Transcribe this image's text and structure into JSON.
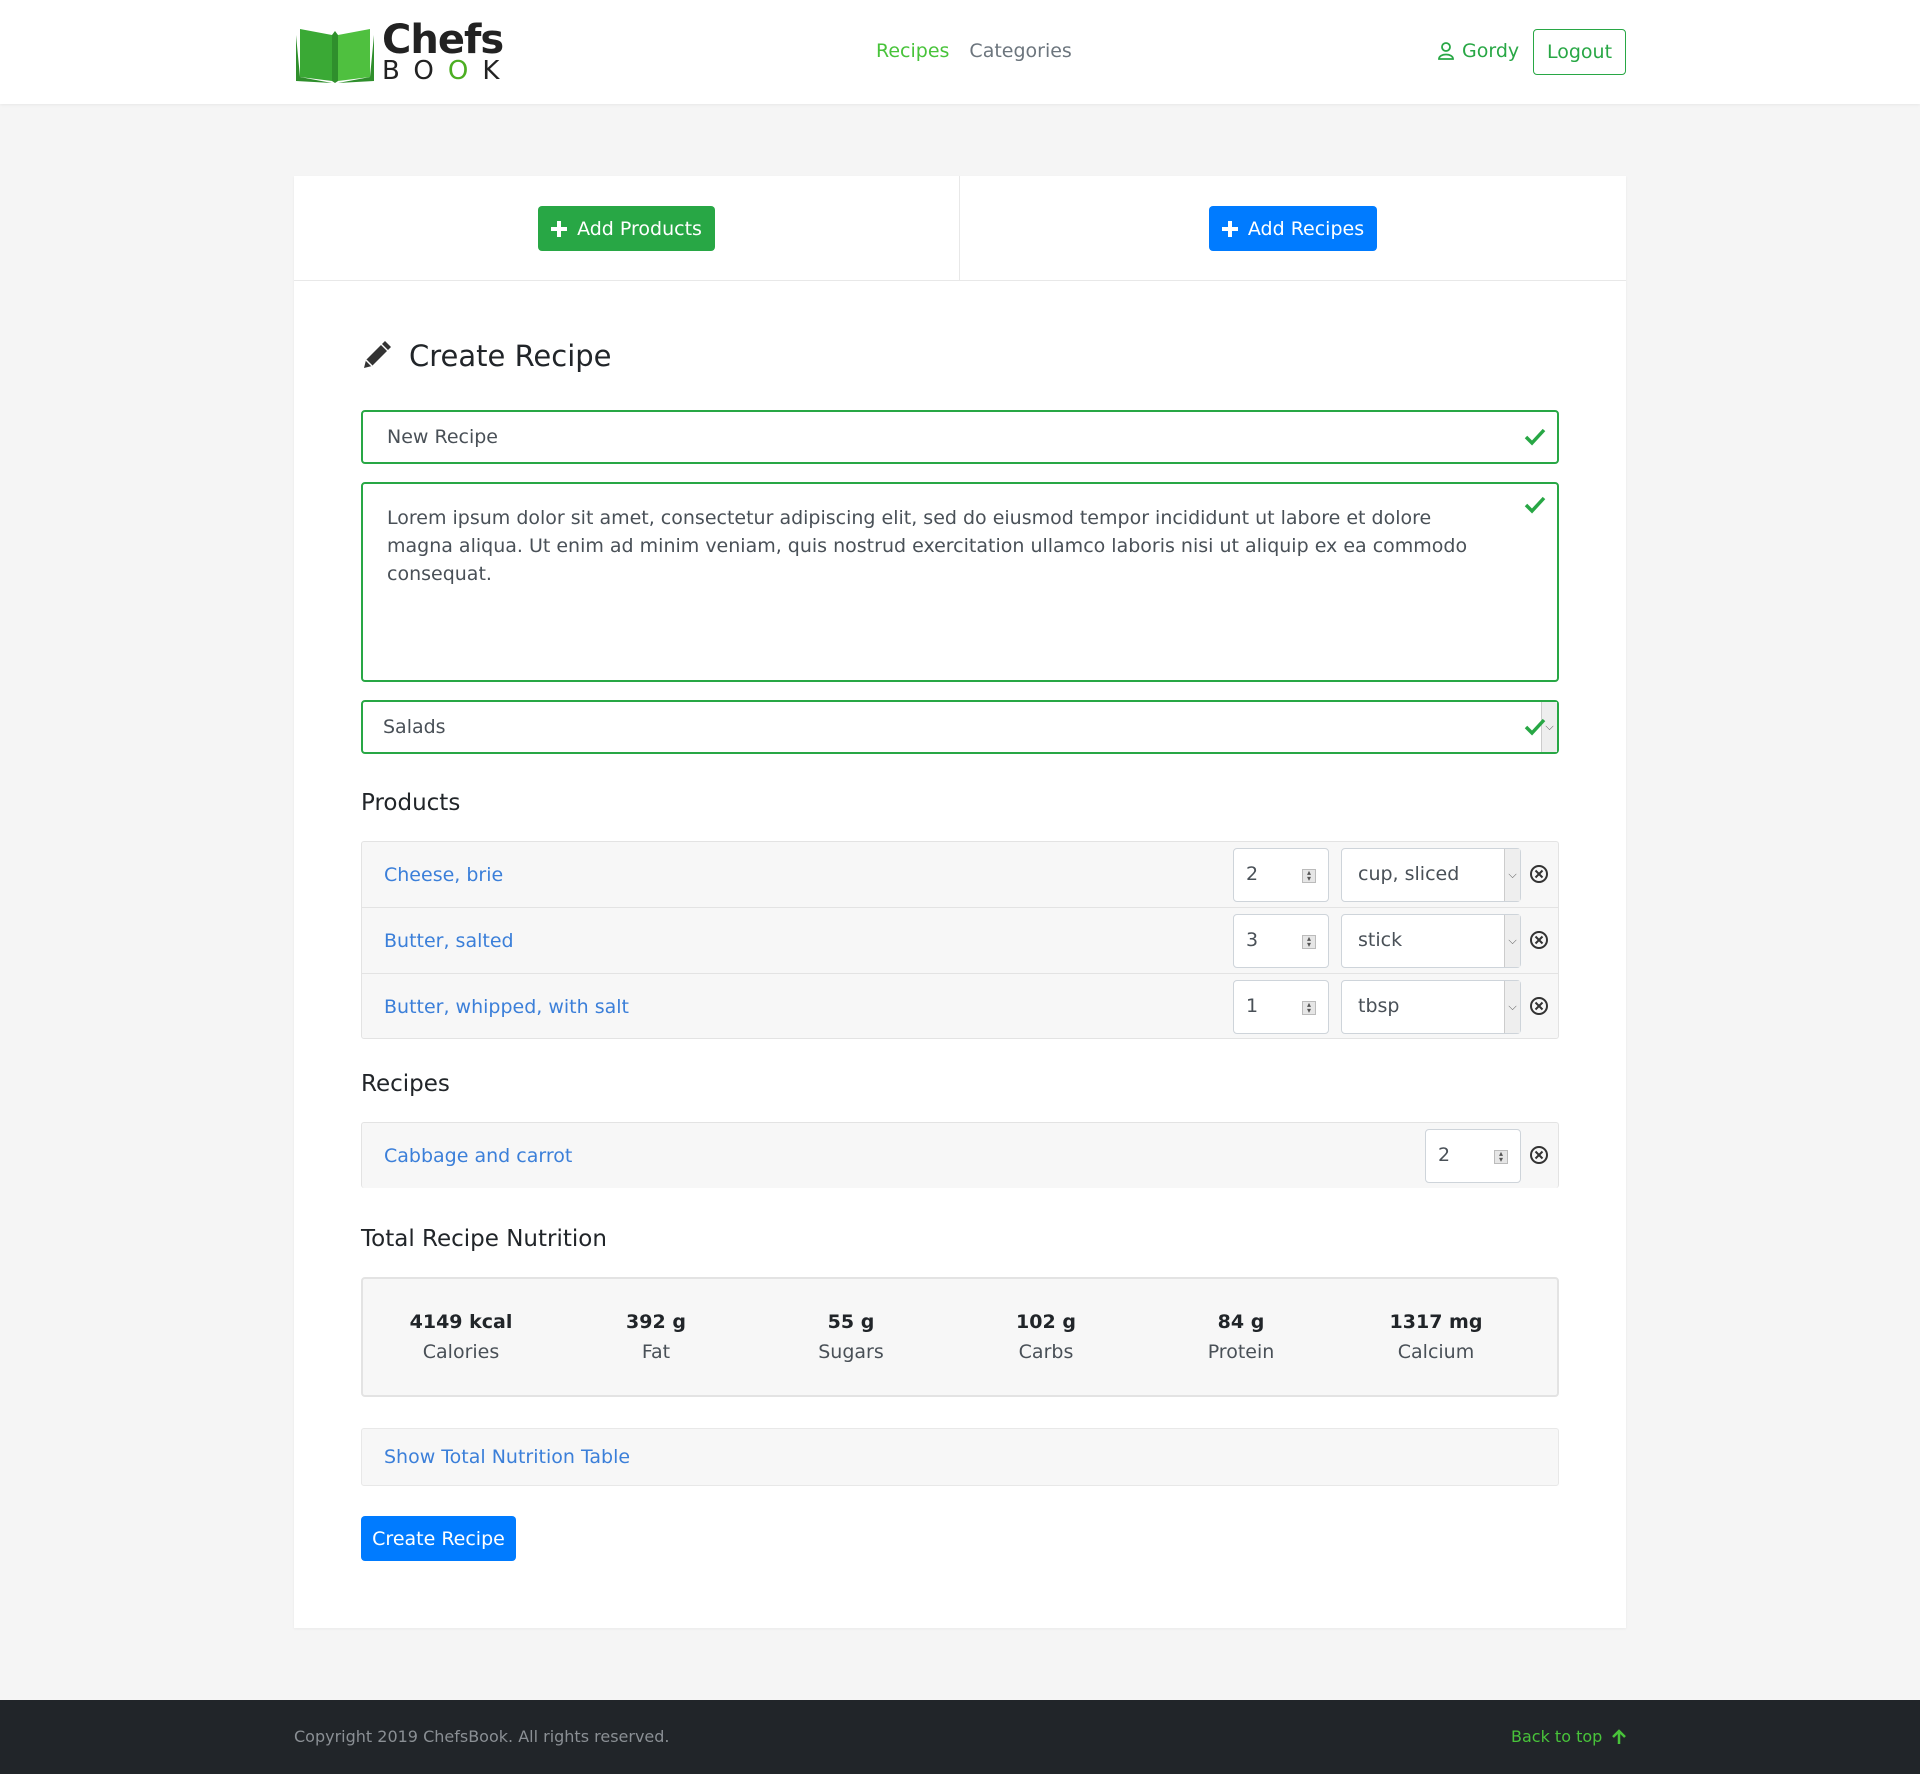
{
  "brand": {
    "line1": "Chefs",
    "line2": [
      "B",
      "O",
      "O",
      "K"
    ]
  },
  "nav": {
    "recipes": "Recipes",
    "categories": "Categories"
  },
  "user": {
    "name": "Gordy",
    "logout": "Logout"
  },
  "actions": {
    "add_products": "Add Products",
    "add_recipes": "Add Recipes"
  },
  "form": {
    "heading": "Create Recipe",
    "name_value": "New Recipe",
    "description_value": "Lorem ipsum dolor sit amet, consectetur adipiscing elit, sed do eiusmod tempor incididunt ut labore et dolore magna aliqua. Ut enim ad minim veniam, quis nostrud exercitation ullamco laboris nisi ut aliquip ex ea commodo consequat.",
    "category_value": "Salads"
  },
  "products": {
    "title": "Products",
    "items": [
      {
        "name": "Cheese, brie",
        "quantity": "2",
        "unit": "cup, sliced"
      },
      {
        "name": "Butter, salted",
        "quantity": "3",
        "unit": "stick"
      },
      {
        "name": "Butter, whipped, with salt",
        "quantity": "1",
        "unit": "tbsp"
      }
    ]
  },
  "recipes": {
    "title": "Recipes",
    "items": [
      {
        "name": "Cabbage and carrot",
        "quantity": "2"
      }
    ]
  },
  "nutrition": {
    "title": "Total Recipe Nutrition",
    "items": [
      {
        "value": "4149 kcal",
        "label": "Calories"
      },
      {
        "value": "392 g",
        "label": "Fat"
      },
      {
        "value": "55 g",
        "label": "Sugars"
      },
      {
        "value": "102 g",
        "label": "Carbs"
      },
      {
        "value": "84 g",
        "label": "Protein"
      },
      {
        "value": "1317 mg",
        "label": "Calcium"
      }
    ],
    "show_table": "Show Total Nutrition Table"
  },
  "submit": "Create Recipe",
  "footer": {
    "copyright": "Copyright 2019 ChefsBook. All rights reserved.",
    "back_to_top": "Back to top"
  },
  "colors": {
    "green": "#28a745",
    "blue": "#007bff",
    "link": "#3b7fd9",
    "nav_active": "#48c33a"
  },
  "icons": [
    "user-icon",
    "plus-icon",
    "pencil-icon",
    "check-icon",
    "remove-circle-icon",
    "arrow-up-icon"
  ]
}
